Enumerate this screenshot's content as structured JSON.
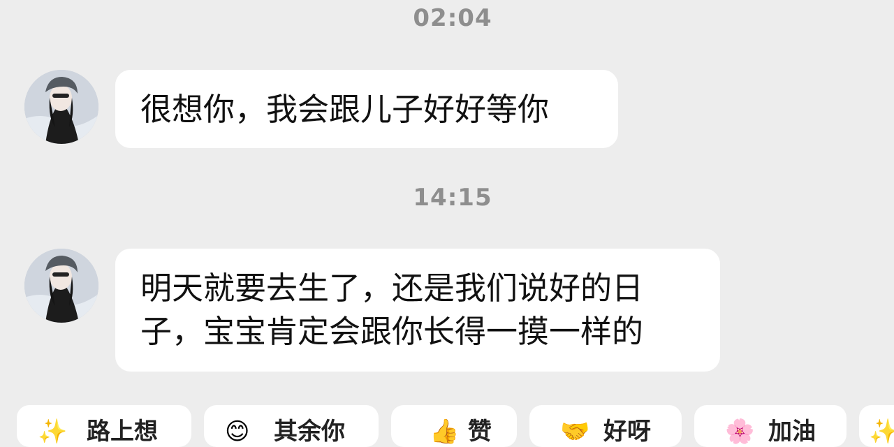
{
  "messages": [
    {
      "time": "02:04",
      "text": "很想你，我会跟儿子好好等你"
    },
    {
      "time": "14:15",
      "line1": "明天就要去生了，还是我们说好的日",
      "line2": "子，宝宝肯定会跟你长得一摸一样的"
    }
  ],
  "quick_replies": [
    {
      "icon": "hearts-icon",
      "glyph": "✨",
      "label": "路上想"
    },
    {
      "icon": "smile-icon",
      "glyph": "😊",
      "label": "其余你"
    },
    {
      "icon": "thumbs-up-icon",
      "glyph": "👍",
      "label": "赞"
    },
    {
      "icon": "handshake-icon",
      "glyph": "🤝",
      "label": "好呀"
    },
    {
      "icon": "flower-icon",
      "glyph": "🌸",
      "label": "加油"
    },
    {
      "icon": "sparkle-icon",
      "glyph": "✨",
      "label": ""
    }
  ],
  "colors": {
    "background": "#ededed",
    "bubble": "#ffffff",
    "timestamp": "#8e8e8e"
  }
}
